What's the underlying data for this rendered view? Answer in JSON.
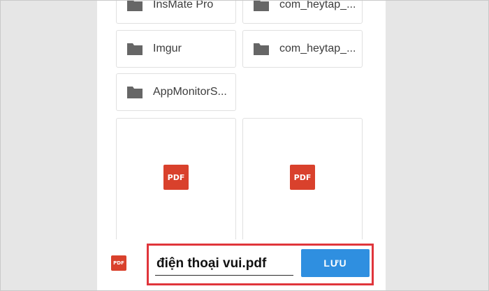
{
  "folders": [
    {
      "label": "InsMate Pro",
      "icon": "folder-icon"
    },
    {
      "label": "com_heytap_...",
      "icon": "folder-icon"
    },
    {
      "label": "Imgur",
      "icon": "folder-icon"
    },
    {
      "label": "com_heytap_...",
      "icon": "folder-icon"
    },
    {
      "label": "AppMonitorS...",
      "icon": "folder-icon"
    }
  ],
  "files": [
    {
      "badge": "PDF",
      "icon": "pdf-file-icon"
    },
    {
      "badge": "PDF",
      "icon": "pdf-file-icon"
    }
  ],
  "save_bar": {
    "file_badge": "PDF",
    "filename_value": "điện thoại vui.pdf",
    "save_label": "LƯU"
  },
  "colors": {
    "pdf_red": "#d9412c",
    "save_blue": "#2f8fe0",
    "highlight_red": "#e0353b",
    "folder_gray": "#666666"
  }
}
